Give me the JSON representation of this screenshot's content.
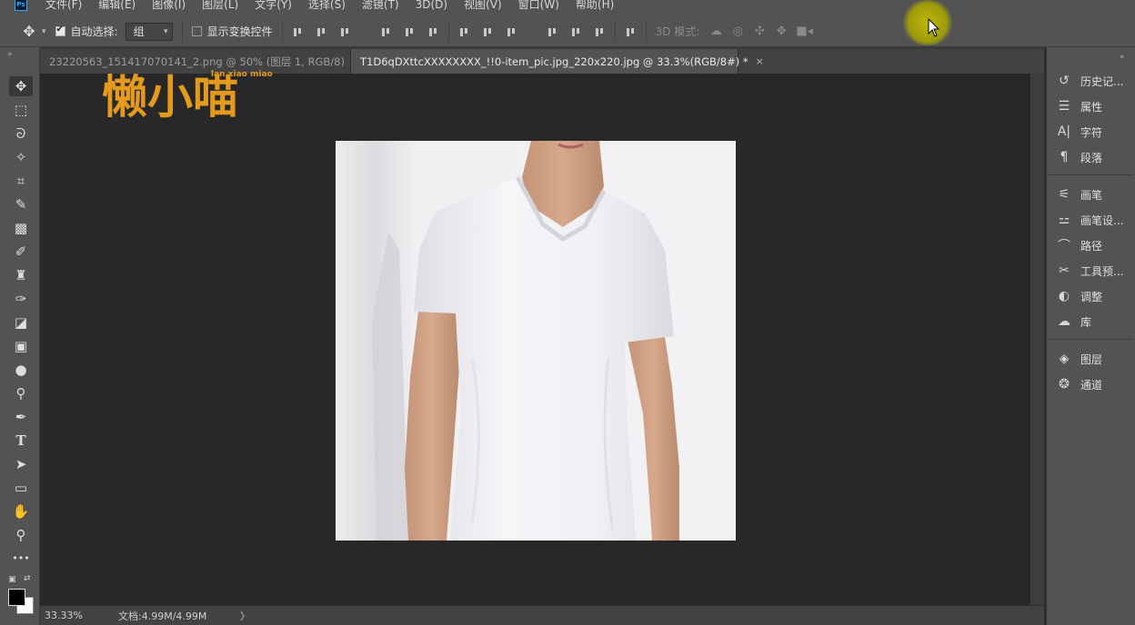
{
  "menubar": {
    "logo": "Ps",
    "items": [
      "文件(F)",
      "编辑(E)",
      "图像(I)",
      "图层(L)",
      "文字(Y)",
      "选择(S)",
      "滤镜(T)",
      "3D(D)",
      "视图(V)",
      "窗口(W)",
      "帮助(H)"
    ]
  },
  "options": {
    "auto_select_label": "自动选择:",
    "auto_select_checked": true,
    "auto_select_value": "组",
    "transform_label": "显示变换控件",
    "transform_checked": false,
    "mode_3d_label": "3D 模式:"
  },
  "tabs": [
    {
      "label": "23220563_151417070141_2.png @ 50% (图层 1, RGB/8)",
      "close": "×",
      "active": false
    },
    {
      "label": "T1D6qDXttcXXXXXXXX_!!0-item_pic.jpg_220x220.jpg @ 33.3%(RGB/8#) *",
      "close": "×",
      "active": true
    }
  ],
  "tools": [
    {
      "name": "move-tool",
      "glyph": "✥",
      "selected": true
    },
    {
      "name": "marquee-tool",
      "glyph": "⬚",
      "selected": false
    },
    {
      "name": "lasso-tool",
      "glyph": "ᘐ",
      "selected": false
    },
    {
      "name": "magic-wand-tool",
      "glyph": "✧",
      "selected": false
    },
    {
      "name": "crop-tool",
      "glyph": "⌗",
      "selected": false
    },
    {
      "name": "eyedropper-tool",
      "glyph": "✎",
      "selected": false
    },
    {
      "name": "spot-healing-tool",
      "glyph": "▩",
      "selected": false
    },
    {
      "name": "brush-tool",
      "glyph": "✐",
      "selected": false
    },
    {
      "name": "clone-stamp-tool",
      "glyph": "♜",
      "selected": false
    },
    {
      "name": "history-brush-tool",
      "glyph": "✑",
      "selected": false
    },
    {
      "name": "eraser-tool",
      "glyph": "◪",
      "selected": false
    },
    {
      "name": "gradient-tool",
      "glyph": "▣",
      "selected": false
    },
    {
      "name": "blur-tool",
      "glyph": "●",
      "selected": false
    },
    {
      "name": "dodge-tool",
      "glyph": "⚲",
      "selected": false
    },
    {
      "name": "pen-tool",
      "glyph": "✒",
      "selected": false
    },
    {
      "name": "type-tool",
      "glyph": "T",
      "selected": false
    },
    {
      "name": "path-selection-tool",
      "glyph": "➤",
      "selected": false
    },
    {
      "name": "rectangle-tool",
      "glyph": "▭",
      "selected": false
    },
    {
      "name": "hand-tool",
      "glyph": "✋",
      "selected": false
    },
    {
      "name": "zoom-tool",
      "glyph": "⚲",
      "selected": false
    },
    {
      "name": "more-tools",
      "glyph": "•••",
      "selected": false
    }
  ],
  "watermark": {
    "main": "懒小喵",
    "pinyin": "lan xiao miao"
  },
  "status": {
    "zoom": "33.33%",
    "doc_info": "文档:4.99M/4.99M",
    "arrow": "〉"
  },
  "panels": [
    {
      "name": "history",
      "icon": "history-icon",
      "glyph": "↺",
      "label": "历史记..."
    },
    {
      "name": "properties",
      "icon": "properties-icon",
      "glyph": "☰",
      "label": "属性"
    },
    {
      "name": "character",
      "icon": "character-icon",
      "glyph": "A|",
      "label": "字符"
    },
    {
      "name": "paragraph",
      "icon": "paragraph-icon",
      "glyph": "¶",
      "label": "段落"
    },
    {
      "name": "brushes",
      "icon": "brushes-icon",
      "glyph": "⚟",
      "label": "画笔"
    },
    {
      "name": "brush-settings",
      "icon": "brush-settings-icon",
      "glyph": "⚍",
      "label": "画笔设..."
    },
    {
      "name": "paths",
      "icon": "paths-icon",
      "glyph": "⌒",
      "label": "路径"
    },
    {
      "name": "tool-presets",
      "icon": "tool-presets-icon",
      "glyph": "✂",
      "label": "工具预..."
    },
    {
      "name": "adjustments",
      "icon": "adjustments-icon",
      "glyph": "◐",
      "label": "调整"
    },
    {
      "name": "libraries",
      "icon": "libraries-icon",
      "glyph": "☁",
      "label": "库"
    },
    {
      "name": "layers",
      "icon": "layers-icon",
      "glyph": "◈",
      "label": "图层"
    },
    {
      "name": "channels",
      "icon": "channels-icon",
      "glyph": "❂",
      "label": "通道"
    }
  ],
  "colors": {
    "watermark": "#e39a1d",
    "canvas_bg": "#282828",
    "photo_bg": "#ececee",
    "accent": "#31a8ff"
  }
}
